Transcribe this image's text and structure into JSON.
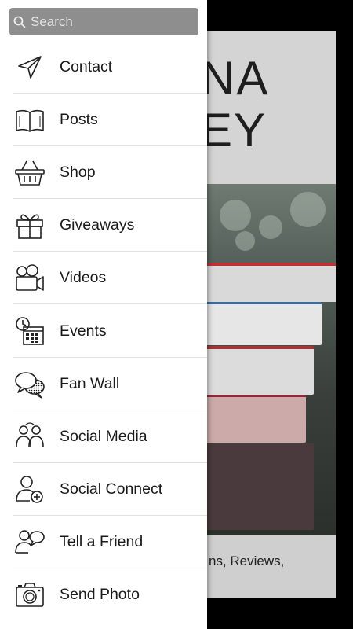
{
  "search": {
    "placeholder": "Search",
    "icon": "search-icon"
  },
  "menu": [
    {
      "label": "Contact",
      "icon": "paper-plane-icon"
    },
    {
      "label": "Posts",
      "icon": "open-book-icon"
    },
    {
      "label": "Shop",
      "icon": "shopping-basket-icon"
    },
    {
      "label": "Giveaways",
      "icon": "gift-icon"
    },
    {
      "label": "Videos",
      "icon": "video-camera-icon"
    },
    {
      "label": "Events",
      "icon": "calendar-clock-icon"
    },
    {
      "label": "Fan Wall",
      "icon": "chat-bubbles-icon"
    },
    {
      "label": "Social Media",
      "icon": "people-group-icon"
    },
    {
      "label": "Social Connect",
      "icon": "add-user-icon"
    },
    {
      "label": "Tell a Friend",
      "icon": "tell-friend-icon"
    },
    {
      "label": "Send Photo",
      "icon": "camera-icon"
    }
  ],
  "background": {
    "title_line1": "NA",
    "title_line2": "EY",
    "caption": "ns, Reviews,"
  }
}
